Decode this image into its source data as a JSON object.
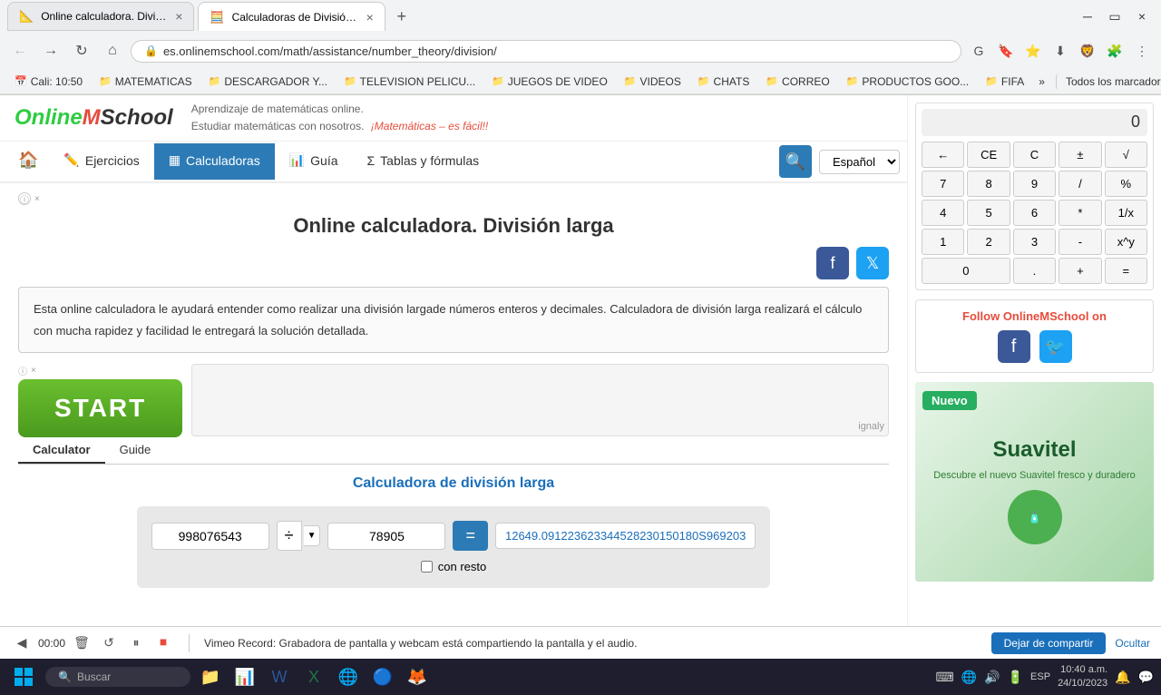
{
  "browser": {
    "tabs": [
      {
        "id": "tab1",
        "title": "Online calculadora. División larg...",
        "url": "es.onlinemschool.com/math/assistance/number_theory/division/",
        "active": false,
        "favicon": "📐"
      },
      {
        "id": "tab2",
        "title": "Calculadoras de División | Calcu...",
        "url": "es.onlinemschool.com/math/assistance/number_theory/division/",
        "active": true,
        "favicon": "🧮"
      }
    ],
    "url": "es.onlinemschool.com/math/assistance/number_theory/division/",
    "nav": {
      "back": "←",
      "forward": "→",
      "refresh": "↻",
      "home": "⌂"
    }
  },
  "bookmarks": [
    {
      "label": "Cali: 10:50",
      "icon": "📅"
    },
    {
      "label": "MATEMATICAS",
      "icon": "📁"
    },
    {
      "label": "DESCARGADOR Y...",
      "icon": "📁"
    },
    {
      "label": "TELEVISION PELICU...",
      "icon": "📁"
    },
    {
      "label": "JUEGOS DE VIDEO",
      "icon": "📁"
    },
    {
      "label": "VIDEOS",
      "icon": "📁"
    },
    {
      "label": "CHATS",
      "icon": "📁"
    },
    {
      "label": "CORREO",
      "icon": "📁"
    },
    {
      "label": "PRODUCTOS GOO...",
      "icon": "📁"
    },
    {
      "label": "FIFA",
      "icon": "📁"
    },
    {
      "label": "»",
      "icon": ""
    },
    {
      "label": "Todos los marcadores",
      "icon": ""
    }
  ],
  "header": {
    "logo": "OnlineMSchool",
    "tagline1": "Aprendizaje de matemáticas online.",
    "tagline2": "Estudiar matemáticas con nosotros.",
    "tagline3": "¡Matemáticas – es fácil!!"
  },
  "nav": {
    "home_icon": "🏠",
    "items": [
      {
        "label": "Ejercicios",
        "icon": "✏️",
        "active": false
      },
      {
        "label": "Calculadoras",
        "icon": "▦",
        "active": true
      },
      {
        "label": "Guía",
        "icon": "📊",
        "active": false
      },
      {
        "label": "Tablas y fórmulas",
        "icon": "Σ",
        "active": false
      }
    ],
    "search_icon": "🔍",
    "language": "Español"
  },
  "page": {
    "title": "Online calculadora. División larga",
    "description": "Esta online calculadora le ayudará entender como realizar una división largade números enteros y decimales. Calculadora de división larga realizará el cálculo con mucha rapidez y facilidad le entregará la solución detallada.",
    "ad_close_label": "×",
    "ad_info_label": "ⓘ",
    "start_button": "START",
    "ignaly_label": "ignaly"
  },
  "tabs": [
    {
      "label": "Calculator",
      "active": true
    },
    {
      "label": "Guide",
      "active": false
    }
  ],
  "calculator": {
    "title": "Calculadora de división larga",
    "input1": "998076543",
    "input2": "78905",
    "op_symbol": "÷",
    "eq_label": "=",
    "result": "12649.091223623344528230150180S969203",
    "checkbox_label": "con resto",
    "checkbox_checked": false
  },
  "sidebar_calc": {
    "display": "0",
    "keys": [
      {
        "label": "←",
        "id": "back"
      },
      {
        "label": "CE",
        "id": "ce"
      },
      {
        "label": "C",
        "id": "c"
      },
      {
        "label": "±",
        "id": "pm"
      },
      {
        "label": "√",
        "id": "sqrt"
      },
      {
        "label": "7",
        "id": "7"
      },
      {
        "label": "8",
        "id": "8"
      },
      {
        "label": "9",
        "id": "9"
      },
      {
        "label": "/",
        "id": "div"
      },
      {
        "label": "%",
        "id": "pct"
      },
      {
        "label": "4",
        "id": "4"
      },
      {
        "label": "5",
        "id": "5"
      },
      {
        "label": "6",
        "id": "6"
      },
      {
        "label": "*",
        "id": "mul"
      },
      {
        "label": "1/x",
        "id": "inv"
      },
      {
        "label": "1",
        "id": "1"
      },
      {
        "label": "2",
        "id": "2"
      },
      {
        "label": "3",
        "id": "3"
      },
      {
        "label": "-",
        "id": "sub"
      },
      {
        "label": "x^y",
        "id": "pow"
      },
      {
        "label": "0",
        "id": "0",
        "wide": true
      },
      {
        "label": ".",
        "id": "dot"
      },
      {
        "label": "+",
        "id": "add"
      },
      {
        "label": "=",
        "id": "eq"
      }
    ]
  },
  "follow": {
    "title": "Follow OnlineMSchool on",
    "fb_icon": "f",
    "tw_icon": "t"
  },
  "sidebar_ad": {
    "nuevo_label": "Nuevo",
    "brand": "Suavitel",
    "close": "×"
  },
  "vimeo": {
    "time": "00:00",
    "message": "Vimeo Record: Grabadora de pantalla y webcam está compartiendo la pantalla y el audio.",
    "share_btn": "Dejar de compartir",
    "hide_btn": "Ocultar"
  },
  "taskbar": {
    "search_placeholder": "Buscar",
    "sys_icons": [
      "🔔",
      "🔋",
      "📶"
    ],
    "time": "10:40 a.m.",
    "date": "24/10/2023",
    "lang": "ESP"
  }
}
